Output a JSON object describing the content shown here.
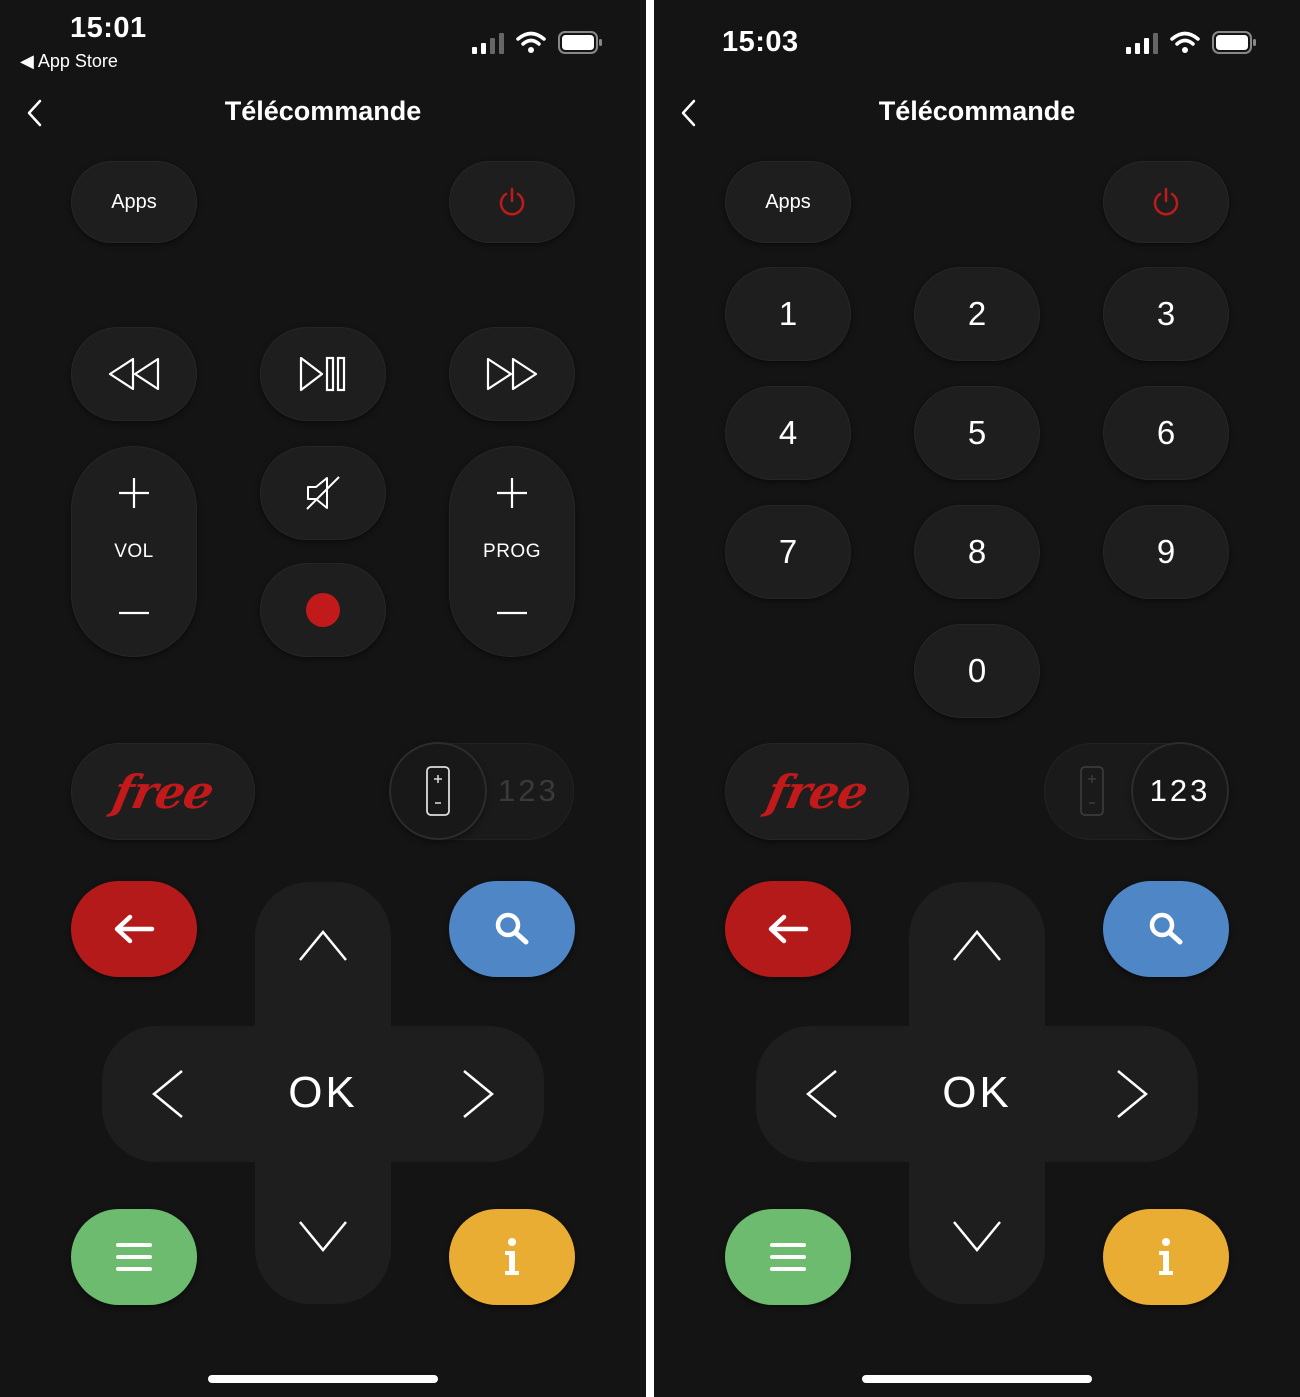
{
  "left": {
    "status": {
      "time": "15:01",
      "back_app": "◀ App Store"
    },
    "header": {
      "title": "Télécommande"
    },
    "apps_label": "Apps",
    "vol_label": "VOL",
    "prog_label": "PROG",
    "free_logo": "free",
    "toggle_label": "123",
    "ok_label": "OK"
  },
  "right": {
    "status": {
      "time": "15:03"
    },
    "header": {
      "title": "Télécommande"
    },
    "apps_label": "Apps",
    "keypad": [
      "1",
      "2",
      "3",
      "4",
      "5",
      "6",
      "7",
      "8",
      "9",
      "0"
    ],
    "free_logo": "free",
    "toggle_label": "123",
    "ok_label": "OK"
  },
  "colors": {
    "background": "#141414",
    "button": "#1e1e1e",
    "power_red": "#c21a1a",
    "record_red": "#c21a1a",
    "back_red": "#b51a1a",
    "search_blue": "#4f86c6",
    "menu_green": "#6cbb6e",
    "info_yellow": "#e9ad34"
  }
}
